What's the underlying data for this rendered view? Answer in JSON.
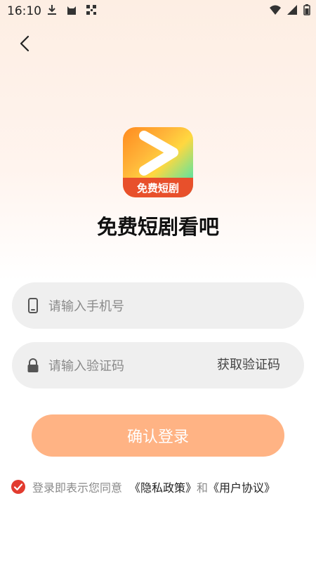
{
  "status_bar": {
    "time": "16:10",
    "icons_left": [
      "download-icon",
      "cat-icon",
      "qr-icon"
    ],
    "icons_right": [
      "wifi-icon",
      "signal-icon",
      "battery-icon"
    ]
  },
  "logo": {
    "badge_text": "免费短剧"
  },
  "app_title": "免费短剧看吧",
  "phone": {
    "placeholder": "请输入手机号",
    "value": ""
  },
  "code": {
    "placeholder": "请输入验证码",
    "value": "",
    "get_code_label": "获取验证码"
  },
  "login_button": "确认登录",
  "agreement": {
    "checked": true,
    "prefix": "登录即表示您同意",
    "privacy_link": "《隐私政策》",
    "and": "和",
    "terms_link": "《用户协议》"
  },
  "colors": {
    "accent": "#ff5a1f",
    "login_button": "#ffb384",
    "check": "#e23b2f"
  }
}
